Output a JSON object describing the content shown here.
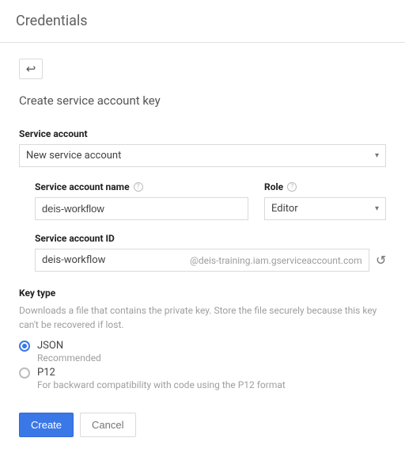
{
  "header": {
    "title": "Credentials"
  },
  "page": {
    "section_title": "Create service account key"
  },
  "service_account": {
    "label": "Service account",
    "selected": "New service account"
  },
  "name_field": {
    "label": "Service account name",
    "value": "deis-workflow"
  },
  "role_field": {
    "label": "Role",
    "selected": "Editor"
  },
  "id_field": {
    "label": "Service account ID",
    "value": "deis-workflow",
    "suffix": "@deis-training.iam.gserviceaccount.com"
  },
  "key_type": {
    "label": "Key type",
    "description": "Downloads a file that contains the private key. Store the file securely because this key can't be recovered if lost.",
    "options": [
      {
        "label": "JSON",
        "sub": "Recommended",
        "checked": true
      },
      {
        "label": "P12",
        "sub": "For backward compatibility with code using the P12 format",
        "checked": false
      }
    ]
  },
  "buttons": {
    "create": "Create",
    "cancel": "Cancel"
  },
  "icons": {
    "back": "↩",
    "help": "?",
    "chevron": "▾",
    "refresh": "↻"
  }
}
